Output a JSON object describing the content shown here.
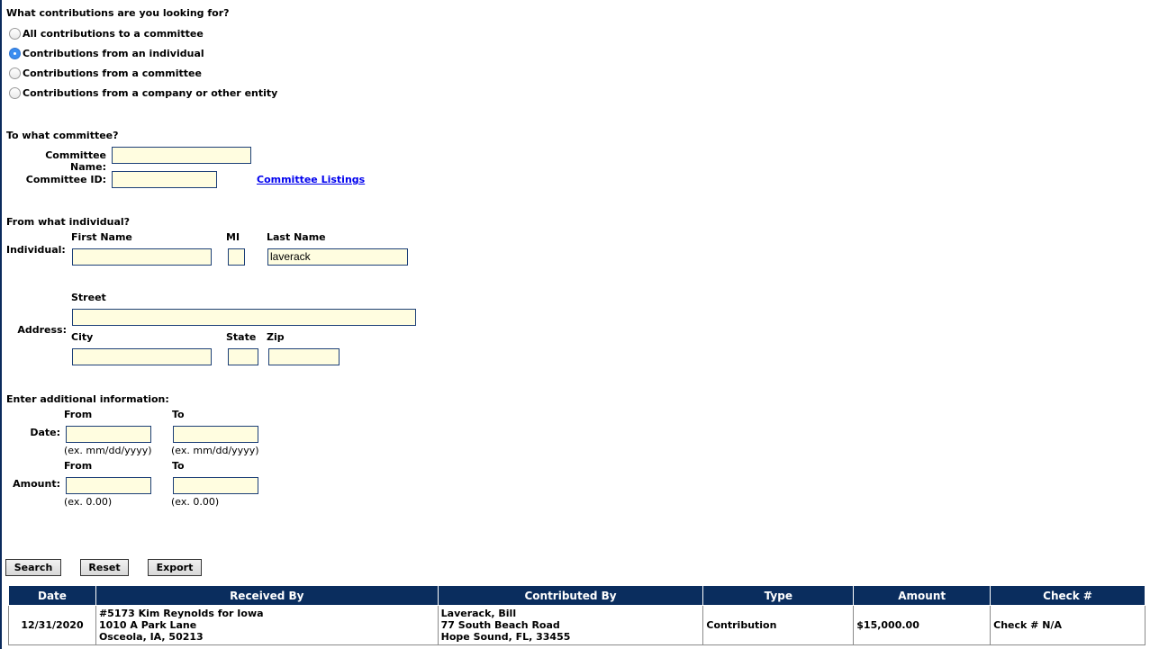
{
  "contribution_type": {
    "question": "What contributions are you looking for?",
    "options": [
      {
        "label": "All contributions to a committee",
        "checked": false
      },
      {
        "label": "Contributions from an individual",
        "checked": true
      },
      {
        "label": "Contributions from a committee",
        "checked": false
      },
      {
        "label": "Contributions from a company or other entity",
        "checked": false
      }
    ]
  },
  "committee": {
    "question": "To what committee?",
    "name_label": "Committee Name:",
    "name_value": "",
    "id_label": "Committee ID:",
    "id_value": "",
    "listings_link": "Committee Listings"
  },
  "individual": {
    "question": "From what individual?",
    "row_label": "Individual:",
    "first_name_label": "First Name",
    "first_name_value": "",
    "mi_label": "MI",
    "mi_value": "",
    "last_name_label": "Last Name",
    "last_name_value": "laverack"
  },
  "address": {
    "row_label": "Address:",
    "street_label": "Street",
    "street_value": "",
    "city_label": "City",
    "city_value": "",
    "state_label": "State",
    "state_value": "",
    "zip_label": "Zip",
    "zip_value": ""
  },
  "additional": {
    "question": "Enter additional information:",
    "date_label": "Date:",
    "date_from_label": "From",
    "date_to_label": "To",
    "date_from_value": "",
    "date_to_value": "",
    "date_hint_from": "(ex. mm/dd/yyyy)",
    "date_hint_to": "(ex. mm/dd/yyyy)",
    "amount_label": "Amount:",
    "amount_from_label": "From",
    "amount_to_label": "To",
    "amount_from_value": "",
    "amount_to_value": "",
    "amount_hint_from": "(ex. 0.00)",
    "amount_hint_to": "(ex. 0.00)"
  },
  "buttons": {
    "search": "Search",
    "reset": "Reset",
    "export": "Export"
  },
  "results": {
    "headers": [
      "Date",
      "Received By",
      "Contributed By",
      "Type",
      "Amount",
      "Check #"
    ],
    "rows": [
      {
        "date": "12/31/2020",
        "received_by": [
          "#5173 Kim Reynolds for Iowa",
          "1010 A Park Lane",
          "Osceola, IA, 50213"
        ],
        "contributed_by": [
          "Laverack, Bill",
          "77 South Beach Road",
          "Hope Sound, FL, 33455"
        ],
        "type": "Contribution",
        "amount": "$15,000.00",
        "check": "Check # N/A"
      }
    ]
  },
  "colors": {
    "header_bg": "#0a2d5e",
    "field_bg": "#fffde0",
    "field_border": "#1c3f77",
    "link": "#0000ee",
    "radio_checked": "#3b8df0"
  }
}
